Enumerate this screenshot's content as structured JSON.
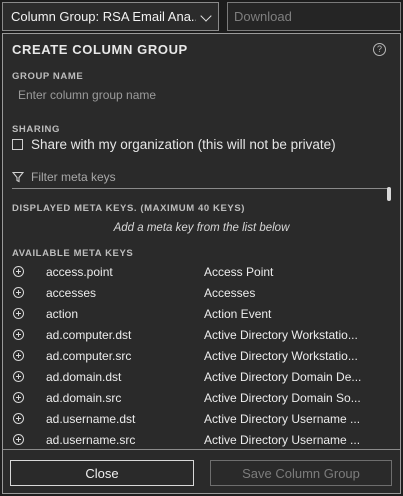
{
  "topbar": {
    "column_group_value": "Column Group: RSA Email Ana...",
    "download_placeholder": "Download"
  },
  "dialog": {
    "title": "CREATE COLUMN GROUP",
    "help_icon": "?",
    "group_name_label": "GROUP NAME",
    "group_name_placeholder": "Enter column group name",
    "sharing_label": "SHARING",
    "share_checkbox_label": "Share with my organization (this will not be private)",
    "share_checked": false,
    "filter_placeholder": "Filter meta keys",
    "displayed_label": "DISPLAYED META KEYS. (MAXIMUM 40 KEYS)",
    "displayed_hint": "Add a meta key from the list below",
    "available_label": "AVAILABLE META KEYS",
    "available_keys": [
      {
        "key": "access.point",
        "name": "Access Point"
      },
      {
        "key": "accesses",
        "name": "Accesses"
      },
      {
        "key": "action",
        "name": "Action Event"
      },
      {
        "key": "ad.computer.dst",
        "name": "Active Directory Workstatio..."
      },
      {
        "key": "ad.computer.src",
        "name": "Active Directory Workstatio..."
      },
      {
        "key": "ad.domain.dst",
        "name": "Active Directory Domain De..."
      },
      {
        "key": "ad.domain.src",
        "name": "Active Directory Domain So..."
      },
      {
        "key": "ad.username.dst",
        "name": "Active Directory Username ..."
      },
      {
        "key": "ad.username.src",
        "name": "Active Directory Username ..."
      }
    ],
    "close_button": "Close",
    "save_button": "Save Column Group"
  }
}
